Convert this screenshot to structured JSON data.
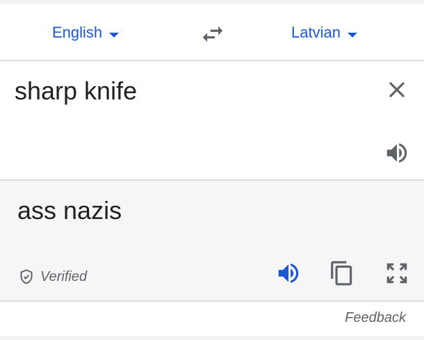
{
  "languages": {
    "source": "English",
    "target": "Latvian"
  },
  "input": {
    "text": "sharp knife"
  },
  "output": {
    "text": "ass nazis",
    "verified_label": "Verified"
  },
  "footer": {
    "feedback_label": "Feedback"
  },
  "icons": {
    "swap": "swap-arrows-icon",
    "clear": "close-icon",
    "source_speaker": "speaker-icon",
    "result_speaker": "speaker-icon",
    "copy": "copy-icon",
    "fullscreen": "fullscreen-icon",
    "verified": "shield-check-icon"
  },
  "colors": {
    "accent": "#1a57d2",
    "icon_gray": "#5f6368",
    "text": "#202124",
    "result_bg": "#f6f6f6"
  }
}
